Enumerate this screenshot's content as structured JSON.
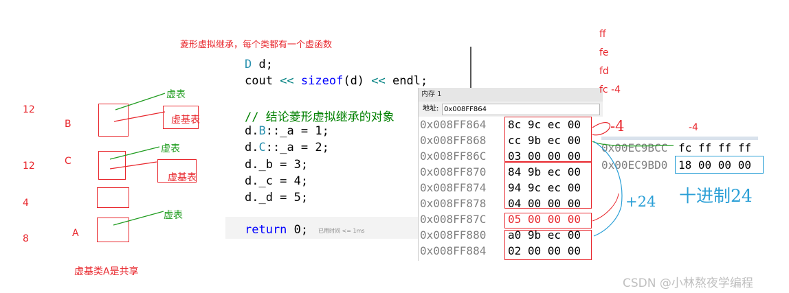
{
  "title_note": "菱形虚拟继承，每个类都有一个虚函数",
  "left_diagram": {
    "sizes": [
      "12",
      "12",
      "4",
      "8"
    ],
    "class_labels": [
      "B",
      "C",
      "A"
    ],
    "vtable_label": "虚表",
    "vbtable_label": "虚基表",
    "footer": "虚基类A是共享"
  },
  "code": {
    "line1_type": "D",
    "line1_rest": " d;",
    "line2_a": "cout ",
    "line2_op1": "<<",
    "line2_fn": " sizeof",
    "line2_b": "(d) ",
    "line2_op2": "<<",
    "line2_c": " endl;",
    "comment": "// 结论菱形虚拟继承的对象",
    "assign1_a": "d.",
    "assign1_cls": "B",
    "assign1_b": "::_a = 1;",
    "assign2_a": "d.",
    "assign2_cls": "C",
    "assign2_b": "::_a = 2;",
    "assign3": "d._b = 3;",
    "assign4": "d._c = 4;",
    "assign5": "d._d = 5;",
    "return_kw": "return",
    "return_rest": " 0;",
    "elapsed": "已用时间 <= 1ms"
  },
  "memory_window": {
    "title": "内存 1",
    "address_label": "地址:",
    "address_value": "0x008FF864",
    "rows": [
      {
        "addr": "0x008FF864",
        "bytes": "8c 9c ec 00"
      },
      {
        "addr": "0x008FF868",
        "bytes": "cc 9b ec 00"
      },
      {
        "addr": "0x008FF86C",
        "bytes": "03 00 00 00"
      },
      {
        "addr": "0x008FF870",
        "bytes": "84 9b ec 00"
      },
      {
        "addr": "0x008FF874",
        "bytes": "94 9c ec 00"
      },
      {
        "addr": "0x008FF878",
        "bytes": "04 00 00 00"
      },
      {
        "addr": "0x008FF87C",
        "bytes": "05 00 00 00"
      },
      {
        "addr": "0x008FF880",
        "bytes": "a0 9b ec 00"
      },
      {
        "addr": "0x008FF884",
        "bytes": "02 00 00 00"
      }
    ]
  },
  "memory_window_2": {
    "rows": [
      {
        "addr": "0x00EC9BCC",
        "bytes": "fc ff ff ff"
      },
      {
        "addr": "0x00EC9BD0",
        "bytes": "18 00 00 00"
      }
    ]
  },
  "annotations": {
    "hex_ff": "ff",
    "hex_fe": "fe",
    "hex_fd": "fd",
    "hex_fc": "fc  -4",
    "minus4_big": "-4",
    "minus4_small": "-4",
    "plus24": "+24",
    "decimal24": "十进制24"
  },
  "watermark": "CSDN @小林熬夜学编程",
  "colors": {
    "annotation_red": "#e8262c",
    "annotation_green": "#1f9c1f",
    "annotation_blue": "#2a9fd6",
    "keyword_blue": "#0000ff",
    "type_teal": "#2b91af",
    "comment_green": "#008000"
  }
}
